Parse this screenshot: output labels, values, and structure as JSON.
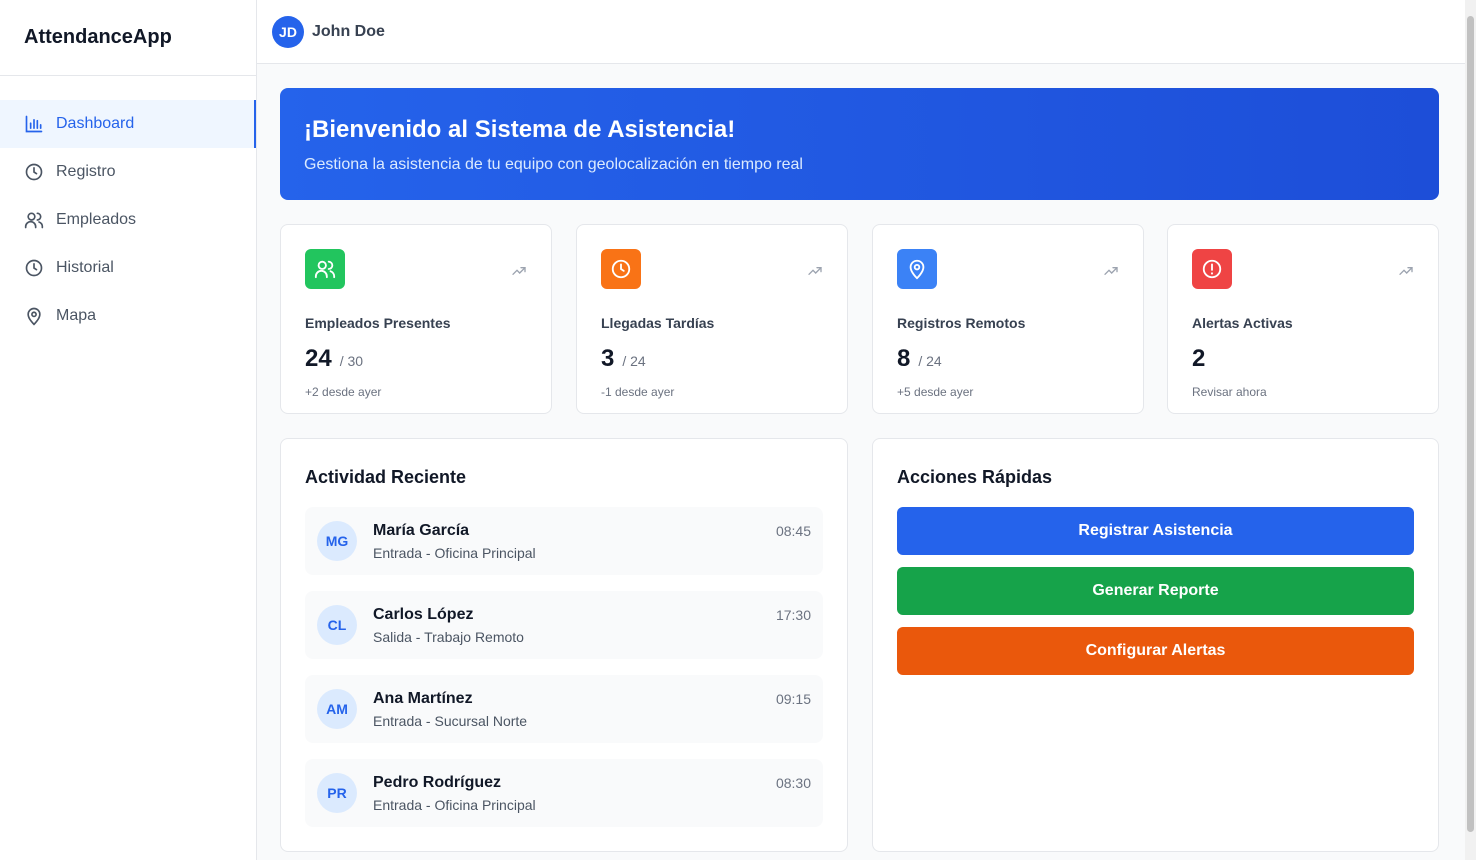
{
  "app": {
    "title": "AttendanceApp"
  },
  "sidebar": {
    "items": [
      {
        "label": "Dashboard",
        "icon": "bar-chart-icon",
        "active": true
      },
      {
        "label": "Registro",
        "icon": "clock-icon"
      },
      {
        "label": "Empleados",
        "icon": "users-icon"
      },
      {
        "label": "Historial",
        "icon": "clock-icon"
      },
      {
        "label": "Mapa",
        "icon": "map-pin-icon"
      }
    ]
  },
  "header": {
    "user_initials": "JD",
    "user_name": "John Doe"
  },
  "banner": {
    "title": "¡Bienvenido al Sistema de Asistencia!",
    "subtitle": "Gestiona la asistencia de tu equipo con geolocalización en tiempo real"
  },
  "stats": [
    {
      "label": "Empleados Presentes",
      "value": "24",
      "total": "/ 30",
      "note": "+2 desde ayer",
      "icon": "users-icon",
      "color": "#22c55e"
    },
    {
      "label": "Llegadas Tardías",
      "value": "3",
      "total": "/ 24",
      "note": "-1 desde ayer",
      "icon": "clock-icon",
      "color": "#f97316"
    },
    {
      "label": "Registros Remotos",
      "value": "8",
      "total": "/ 24",
      "note": "+5 desde ayer",
      "icon": "map-pin-icon",
      "color": "#3b82f6"
    },
    {
      "label": "Alertas Activas",
      "value": "2",
      "total": "",
      "note": "Revisar ahora",
      "icon": "alert-circle-icon",
      "color": "#ef4444"
    }
  ],
  "activity": {
    "title": "Actividad Reciente",
    "items": [
      {
        "initials": "MG",
        "name": "María García",
        "desc": "Entrada - Oficina Principal",
        "time": "08:45"
      },
      {
        "initials": "CL",
        "name": "Carlos López",
        "desc": "Salida - Trabajo Remoto",
        "time": "17:30"
      },
      {
        "initials": "AM",
        "name": "Ana Martínez",
        "desc": "Entrada - Sucursal Norte",
        "time": "09:15"
      },
      {
        "initials": "PR",
        "name": "Pedro Rodríguez",
        "desc": "Entrada - Oficina Principal",
        "time": "08:30"
      }
    ]
  },
  "quick_actions": {
    "title": "Acciones Rápidas",
    "buttons": [
      {
        "label": "Registrar Asistencia",
        "color": "#2563eb"
      },
      {
        "label": "Generar Reporte",
        "color": "#16a34a"
      },
      {
        "label": "Configurar Alertas",
        "color": "#ea580c"
      }
    ]
  }
}
